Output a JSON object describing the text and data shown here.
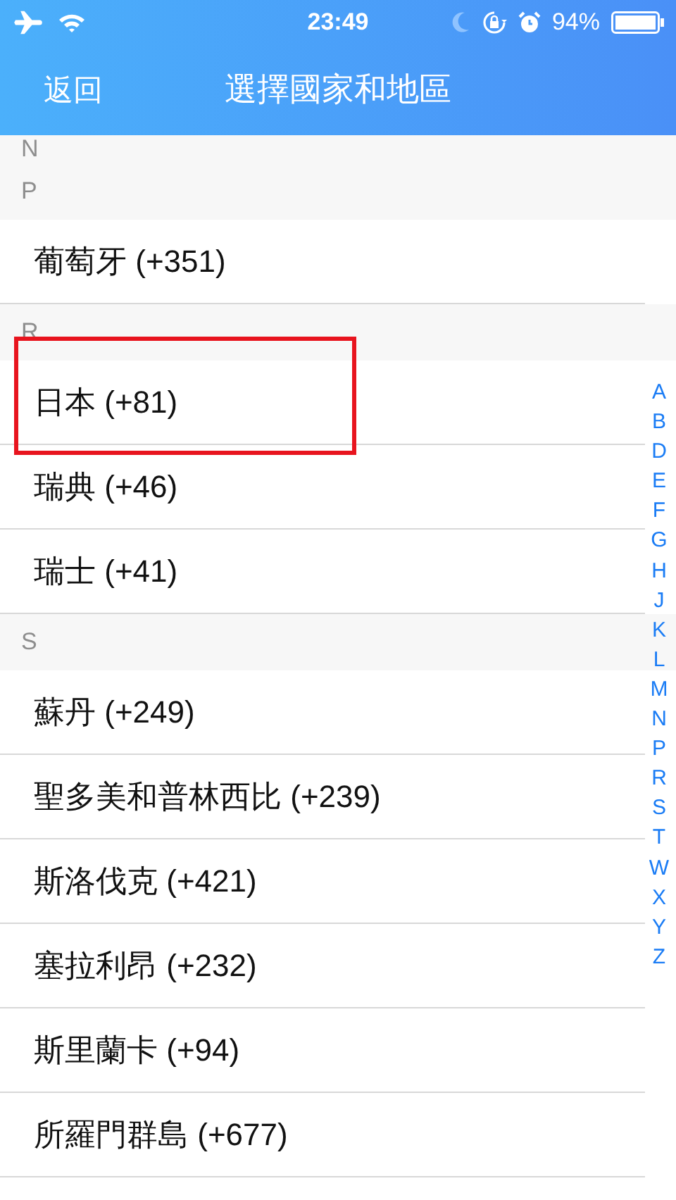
{
  "status_bar": {
    "time": "23:49",
    "battery": "94%"
  },
  "nav": {
    "back": "返回",
    "title": "選擇國家和地區"
  },
  "sections": [
    {
      "letter": "N"
    },
    {
      "letter": "P",
      "rows": [
        {
          "name": "葡萄牙 (+351)",
          "highlighted": false
        }
      ]
    },
    {
      "letter": "R",
      "rows": [
        {
          "name": "日本 (+81)",
          "highlighted": true
        },
        {
          "name": "瑞典 (+46)",
          "highlighted": false
        },
        {
          "name": "瑞士 (+41)",
          "highlighted": false
        }
      ]
    },
    {
      "letter": "S",
      "rows": [
        {
          "name": "蘇丹 (+249)",
          "highlighted": false
        },
        {
          "name": "聖多美和普林西比 (+239)",
          "highlighted": false
        },
        {
          "name": "斯洛伐克 (+421)",
          "highlighted": false
        },
        {
          "name": "塞拉利昂 (+232)",
          "highlighted": false
        },
        {
          "name": "斯里蘭卡 (+94)",
          "highlighted": false
        },
        {
          "name": "所羅門群島 (+677)",
          "highlighted": false
        }
      ]
    }
  ],
  "index": [
    "A",
    "B",
    "D",
    "E",
    "F",
    "G",
    "H",
    "J",
    "K",
    "L",
    "M",
    "N",
    "P",
    "R",
    "S",
    "T",
    "W",
    "X",
    "Y",
    "Z"
  ]
}
